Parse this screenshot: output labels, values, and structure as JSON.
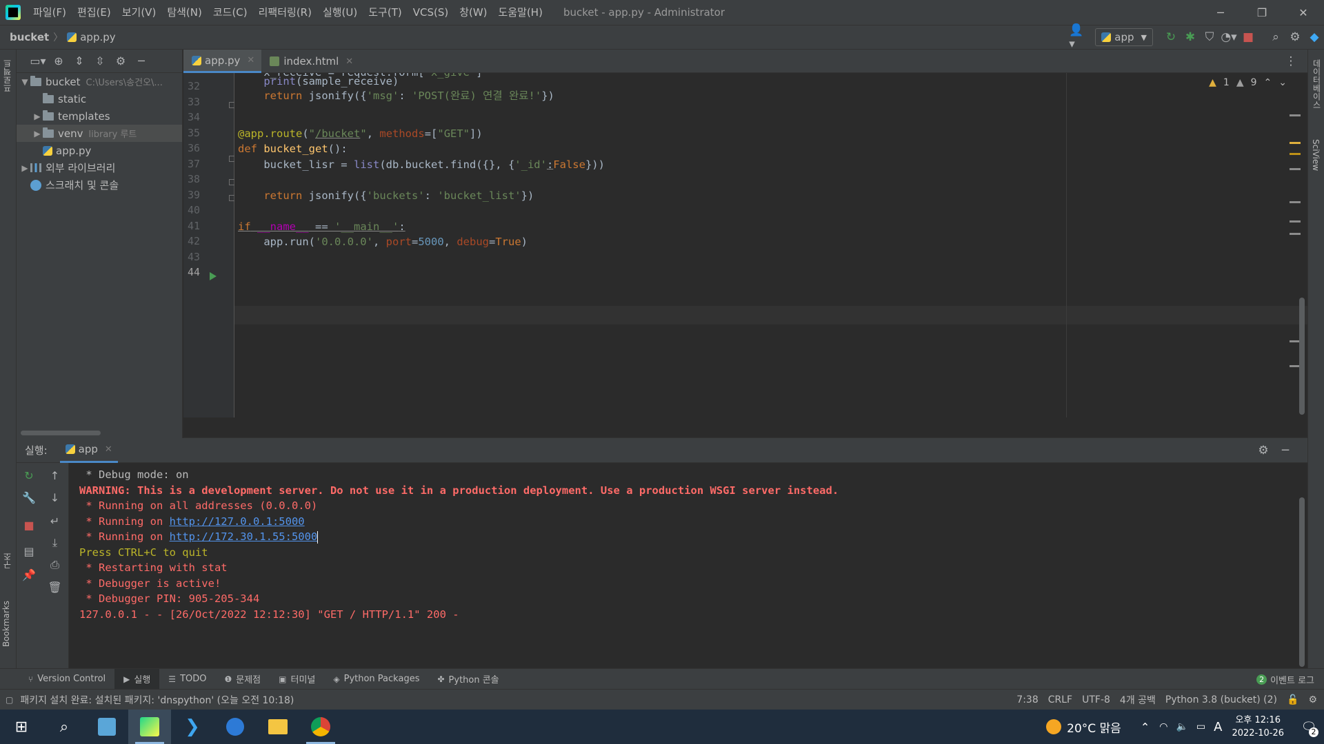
{
  "window": {
    "menu": [
      "파일(F)",
      "편집(E)",
      "보기(V)",
      "탐색(N)",
      "코드(C)",
      "리팩터링(R)",
      "실행(U)",
      "도구(T)",
      "VCS(S)",
      "창(W)",
      "도움말(H)"
    ],
    "title": "bucket - app.py - Administrator"
  },
  "navbar": {
    "project": "bucket",
    "file": "app.py",
    "run_config": "app"
  },
  "left_strip": {
    "project_label": "프로젝트",
    "structure_label": "구조",
    "bookmarks_label": "Bookmarks"
  },
  "right_strip": {
    "database_label": "데이터베이스",
    "sciview_label": "SciView"
  },
  "project_tree": [
    {
      "label": "bucket",
      "hint": "C:\\Users\\송건오\\...",
      "level": 0,
      "expanded": true,
      "type": "folder"
    },
    {
      "label": "static",
      "hint": "",
      "level": 1,
      "expanded": false,
      "type": "folder"
    },
    {
      "label": "templates",
      "hint": "",
      "level": 1,
      "expanded": false,
      "type": "folder"
    },
    {
      "label": "venv",
      "hint": "library 루트",
      "level": 1,
      "expanded": false,
      "type": "folder"
    },
    {
      "label": "app.py",
      "hint": "",
      "level": 1,
      "expanded": false,
      "type": "python"
    },
    {
      "label": "외부 라이브러리",
      "hint": "",
      "level": 0,
      "expanded": false,
      "type": "library"
    },
    {
      "label": "스크래치 및 콘솔",
      "hint": "",
      "level": 0,
      "expanded": false,
      "type": "scratch"
    }
  ],
  "editor_tabs": [
    {
      "label": "app.py",
      "active": true
    },
    {
      "label": "index.html",
      "active": false
    }
  ],
  "inspections": {
    "warnings": "1",
    "weak_warnings": "9"
  },
  "code": {
    "line_numbers": [
      "32",
      "33",
      "34",
      "35",
      "36",
      "37",
      "38",
      "39",
      "40",
      "41",
      "42",
      "43",
      "44"
    ],
    "current_line": "44"
  },
  "run_panel": {
    "title": "실행:",
    "tab": "app",
    "console": [
      {
        "text": " * Debug mode: on",
        "style": "plain"
      },
      {
        "text": "WARNING: This is a development server. Do not use it in a production deployment. Use a production WSGI server instead.",
        "style": "warn"
      },
      {
        "text": " * Running on all addresses (0.0.0.0)",
        "style": "red"
      },
      {
        "prefix": " * Running on ",
        "link": "http://127.0.0.1:5000",
        "style": "red"
      },
      {
        "prefix": " * Running on ",
        "link": "http://172.30.1.55:5000",
        "style": "red",
        "caret": true
      },
      {
        "text": "Press CTRL+C to quit",
        "style": "yellow"
      },
      {
        "text": " * Restarting with stat",
        "style": "red"
      },
      {
        "text": " * Debugger is active!",
        "style": "red"
      },
      {
        "text": " * Debugger PIN: 905-205-344",
        "style": "red"
      },
      {
        "text": "127.0.0.1 - - [26/Oct/2022 12:12:30] \"GET / HTTP/1.1\" 200 -",
        "style": "red"
      }
    ]
  },
  "tool_windows": [
    "Version Control",
    "실행",
    "TODO",
    "문제점",
    "터미널",
    "Python Packages",
    "Python 콘솔"
  ],
  "event_log": {
    "count": "2",
    "label": "이벤트 로그"
  },
  "statusbar": {
    "message": "패키지 설치 완료: 설치된 패키지: 'dnspython' (오늘 오전 10:18)",
    "position": "7:38",
    "line_sep": "CRLF",
    "encoding": "UTF-8",
    "indent": "4개 공백",
    "interpreter": "Python 3.8 (bucket) (2)"
  },
  "taskbar": {
    "weather": "20°C 맑음",
    "ime": "A",
    "time": "오후 12:16",
    "date": "2022-10-26",
    "notifications": "2"
  }
}
